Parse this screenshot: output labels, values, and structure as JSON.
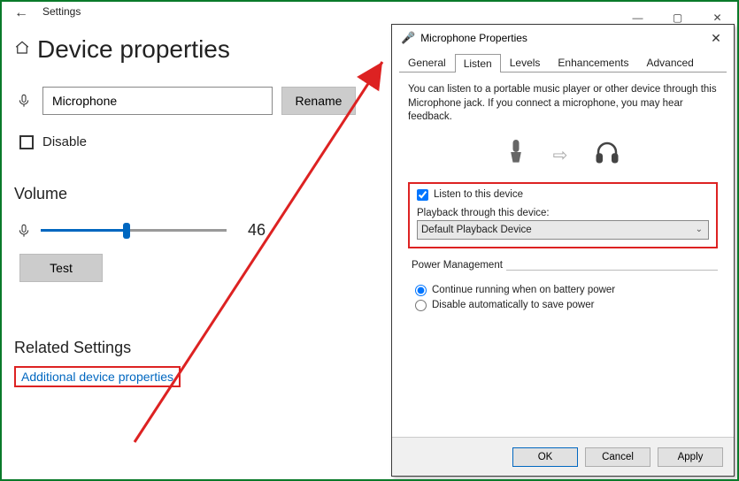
{
  "settings": {
    "window_title": "Settings",
    "page_heading": "Device properties",
    "device_name_value": "Microphone",
    "rename_label": "Rename",
    "disable_label": "Disable",
    "disable_checked": false,
    "volume_heading": "Volume",
    "volume_value": "46",
    "test_label": "Test",
    "related_heading": "Related Settings",
    "related_link": "Additional device properties"
  },
  "dialog": {
    "title": "Microphone Properties",
    "tabs": [
      "General",
      "Listen",
      "Levels",
      "Enhancements",
      "Advanced"
    ],
    "active_tab": "Listen",
    "description": "You can listen to a portable music player or other device through this Microphone jack.  If you connect a microphone, you may hear feedback.",
    "listen_label": "Listen to this device",
    "listen_checked": true,
    "playback_label": "Playback through this device:",
    "playback_value": "Default Playback Device",
    "power_legend": "Power Management",
    "power_options": [
      "Continue running when on battery power",
      "Disable automatically to save power"
    ],
    "power_selected_index": 0,
    "buttons": {
      "ok": "OK",
      "cancel": "Cancel",
      "apply": "Apply"
    }
  }
}
